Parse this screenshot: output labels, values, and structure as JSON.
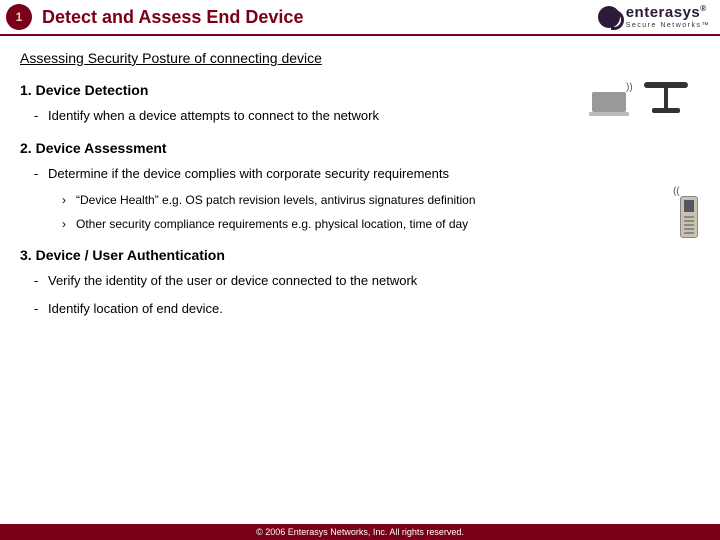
{
  "header": {
    "badge": "1",
    "title": "Detect and Assess End Device",
    "brand": "enterasys",
    "brand_reg": "®",
    "tagline": "Secure Networks™"
  },
  "subtitle": "Assessing Security Posture of connecting device",
  "sections": [
    {
      "num": "1.",
      "title": "Device Detection",
      "items": [
        {
          "text": "Identify when a device attempts to connect to the network"
        }
      ]
    },
    {
      "num": "2.",
      "title": "Device Assessment",
      "items": [
        {
          "text": "Determine if the device complies with corporate security requirements",
          "sub": [
            "“Device Health” e.g. OS patch revision levels, antivirus signatures definition",
            "Other security compliance requirements e.g. physical location, time of day"
          ]
        }
      ]
    },
    {
      "num": "3.",
      "title": "Device / User Authentication",
      "items": [
        {
          "text": "Verify the identity of the user or device connected to the network"
        },
        {
          "text": "Identify location of end device."
        }
      ]
    }
  ],
  "footer": "© 2006 Enterasys Networks, Inc. All rights reserved."
}
